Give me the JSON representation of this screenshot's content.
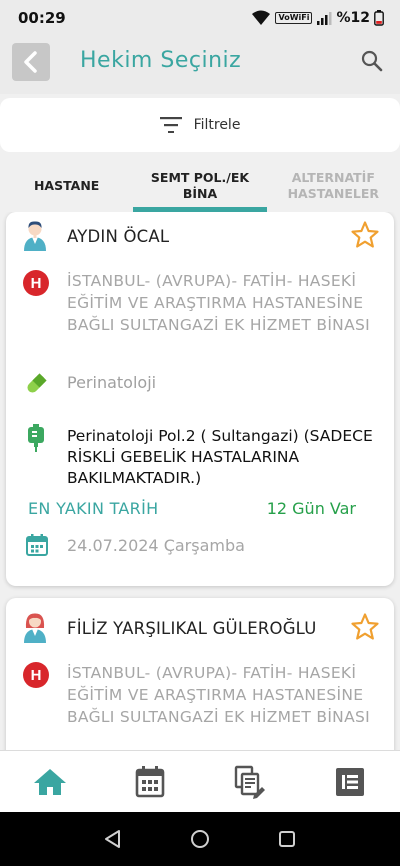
{
  "status_bar": {
    "time": "00:29",
    "network": "VoWiFi",
    "battery": "%12"
  },
  "header": {
    "title": "Hekim Seçiniz"
  },
  "filter": {
    "label": "Filtrele"
  },
  "tabs": [
    {
      "label": "HASTANE",
      "active": false,
      "disabled": false
    },
    {
      "label": "SEMT POL./EK BİNA",
      "active": true,
      "disabled": false
    },
    {
      "label": "ALTERNATİF HASTANELER",
      "active": false,
      "disabled": true
    }
  ],
  "doctors": [
    {
      "name": "AYDIN ÖCAL",
      "hospital": "İSTANBUL- (AVRUPA)- FATİH- HASEKİ EĞİTİM VE ARAŞTIRMA HASTANESİNE BAĞLI SULTANGAZİ EK HİZMET BİNASI",
      "branch": "Perinatoloji",
      "clinic": "Perinatoloji Pol.2 ( Sultangazi) (SADECE RİSKLİ GEBELİK HASTALARINA BAKILMAKTADIR.)",
      "nearest_label": "EN YAKIN TARİH",
      "days_left": "12 Gün Var",
      "date": "24.07.2024 Çarşamba"
    },
    {
      "name": "FİLİZ YARŞILIKAL GÜLEROĞLU",
      "hospital": "İSTANBUL- (AVRUPA)- FATİH- HASEKİ EĞİTİM VE ARAŞTIRMA HASTANESİNE BAĞLI SULTANGAZİ EK HİZMET BİNASI"
    }
  ],
  "colors": {
    "accent": "#3aa6a1",
    "hospital_red": "#d8262b",
    "star": "#f0a030",
    "success": "#26a04a"
  },
  "icons": {
    "bottom_nav": [
      "home-icon",
      "calendar-icon",
      "appointments-icon",
      "menu-icon"
    ],
    "system_nav": [
      "back-icon",
      "home-circle-icon",
      "recents-icon"
    ]
  }
}
